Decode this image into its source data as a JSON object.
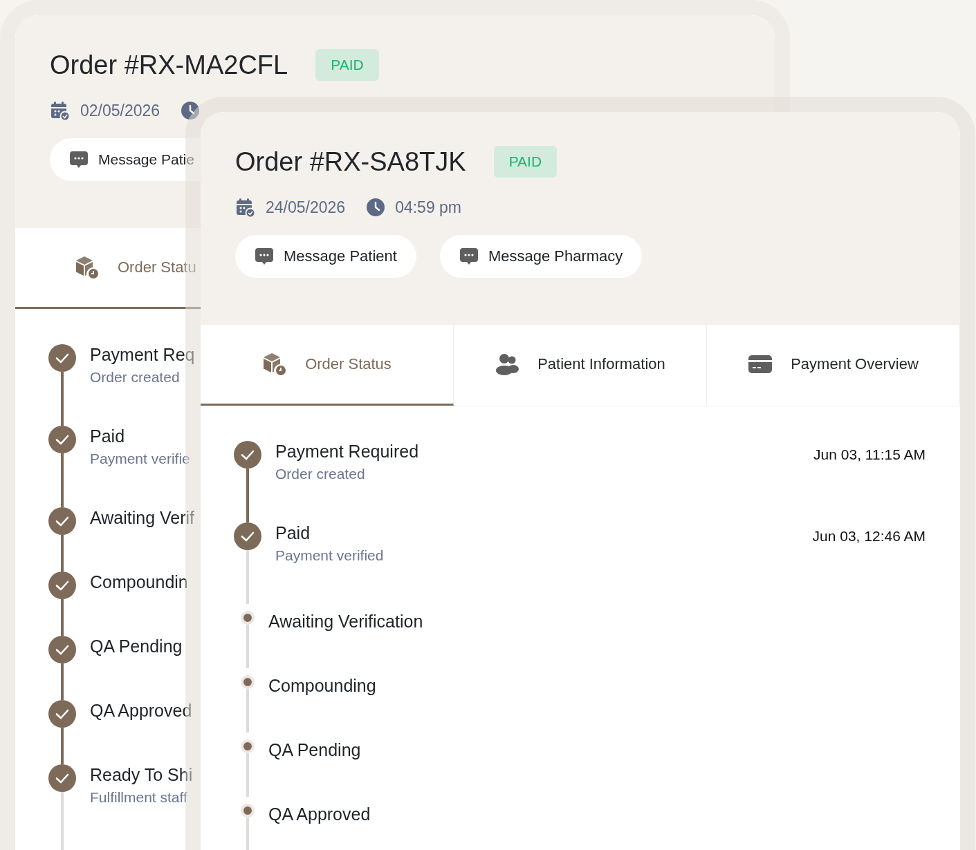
{
  "back_order": {
    "title": "Order #RX-MA2CFL",
    "status": "PAID",
    "date": "02/05/2026",
    "actions": [
      "Message Patie"
    ],
    "tabs": [
      {
        "label": "Order Statu",
        "selected": true
      }
    ],
    "timeline": [
      {
        "title": "Payment Req",
        "subtitle": "Order created",
        "done": true
      },
      {
        "title": "Paid",
        "subtitle": "Payment verifie",
        "done": true
      },
      {
        "title": "Awaiting Verif",
        "done": true
      },
      {
        "title": "Compoundin",
        "done": true
      },
      {
        "title": "QA Pending",
        "done": true
      },
      {
        "title": "QA Approved",
        "done": true
      },
      {
        "title": "Ready To Shi",
        "subtitle": "Fulfillment staff",
        "done": true
      }
    ]
  },
  "front_order": {
    "title": "Order #RX-SA8TJK",
    "status": "PAID",
    "date": "24/05/2026",
    "time": "04:59 pm",
    "actions": [
      "Message Patient",
      "Message Pharmacy"
    ],
    "tabs": [
      {
        "label": "Order Status",
        "selected": true
      },
      {
        "label": "Patient Information",
        "selected": false
      },
      {
        "label": "Payment Overview",
        "selected": false
      }
    ],
    "timeline": [
      {
        "title": "Payment Required",
        "subtitle": "Order created",
        "time": "Jun 03, 11:15 AM",
        "done": true
      },
      {
        "title": "Paid",
        "subtitle": "Payment verified",
        "time": "Jun 03, 12:46 AM",
        "done": true
      },
      {
        "title": "Awaiting Verification",
        "done": false
      },
      {
        "title": "Compounding",
        "done": false
      },
      {
        "title": "QA Pending",
        "done": false
      },
      {
        "title": "QA Approved",
        "done": false
      }
    ]
  }
}
